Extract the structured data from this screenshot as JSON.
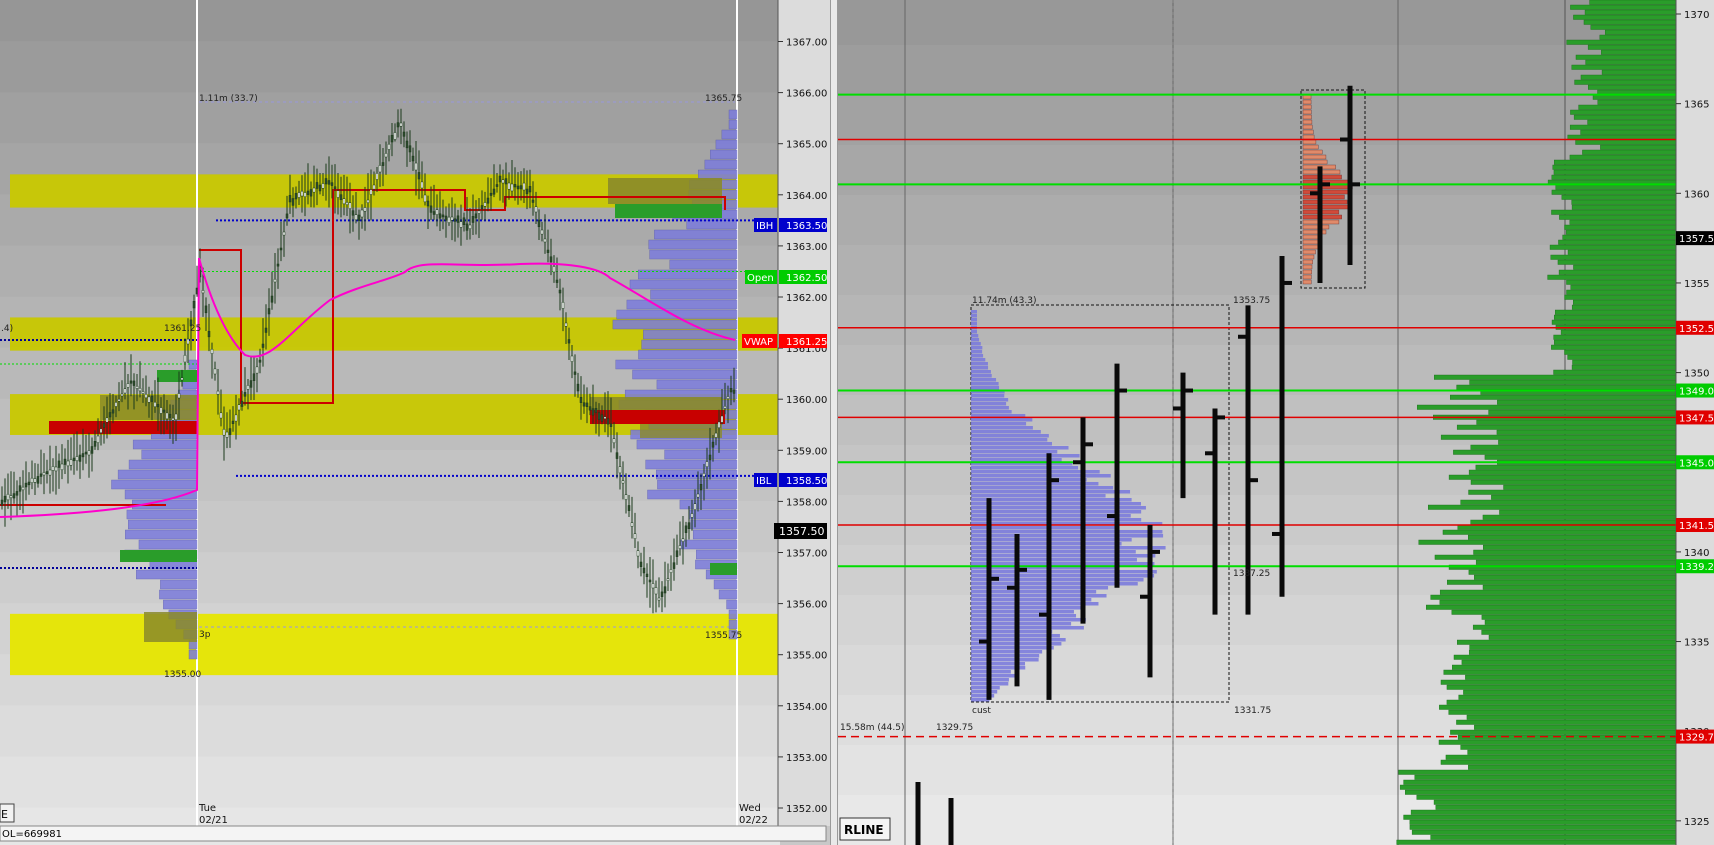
{
  "colors": {
    "yellow_zone": "#c8c800",
    "bright_yellow_zone": "#e6e600",
    "profile_blue": "#7b7bdc",
    "profile_green": "#2a9d2a",
    "profile_olive": "#8a8a2a",
    "profile_red": "#c80000",
    "vwap_magenta": "#ff00cc",
    "ib_blue": "#0000cc",
    "level_green": "#00dd00",
    "level_red": "#e00000",
    "candle": "#1b3a1b",
    "bar_black": "#0a0a0a"
  },
  "left_chart": {
    "price_ticks": [
      "1367.00",
      "1366.00",
      "1365.00",
      "1364.00",
      "1363.00",
      "1362.00",
      "1361.00",
      "1360.00",
      "1359.00",
      "1358.00",
      "1357.00",
      "1356.00",
      "1355.00",
      "1354.00",
      "1353.00",
      "1352.00"
    ],
    "labels": {
      "ibh": {
        "tag": "IBH",
        "value": "1363.50"
      },
      "open": {
        "tag": "Open",
        "value": "1362.50"
      },
      "vwap": {
        "tag": "VWAP",
        "value": "1361.25"
      },
      "ibl": {
        "tag": "IBL",
        "value": "1358.50"
      },
      "last": "1357.50"
    },
    "annotations": {
      "range_top": "1.11m (33.7)",
      "range_high": "1365.75",
      "range_low": "1355.75",
      "prior_level": "1361.25",
      "prior_low": "1355.00",
      "left_stub": ".4)",
      "time_mark": "3p"
    },
    "date_labels": [
      {
        "day": "Tue",
        "date": "02/21"
      },
      {
        "day": "Wed",
        "date": "02/22"
      }
    ],
    "status": {
      "corner_label": "E",
      "volume_text": "OL=669981"
    }
  },
  "right_chart": {
    "price_ticks": [
      "1370",
      "1365",
      "1360",
      "1355",
      "1350",
      "1345",
      "1340",
      "1335",
      "1330",
      "1325"
    ],
    "level_labels": [
      "1357.5",
      "1352.5",
      "1349.0",
      "1347.5",
      "1345.0",
      "1341.5",
      "1339.2",
      "1329.7"
    ],
    "annotations": {
      "profile_stat": "11.74m (43.3)",
      "profile_high": "1353.75",
      "profile_mid": "1337.25",
      "profile_low": "1331.75",
      "profile_name": "cust",
      "composite_stat": "15.58m (44.5)",
      "composite_level": "1329.75"
    },
    "button_label": "RLINE"
  },
  "chart_data": [
    {
      "type": "candlestick",
      "title": "",
      "xlabel": "",
      "ylabel": "",
      "ylim": [
        1351.6,
        1367.6
      ],
      "x_labels": [
        "Tue 02/21",
        "Wed 02/22"
      ],
      "levels": [
        {
          "name": "IBH",
          "value": 1363.5
        },
        {
          "name": "Open",
          "value": 1362.5
        },
        {
          "name": "VWAP",
          "value": 1361.25
        },
        {
          "name": "IBL",
          "value": 1358.5
        },
        {
          "name": "Last",
          "value": 1357.5
        }
      ],
      "session_range": {
        "high": 1365.75,
        "low": 1355.75,
        "volume": "1.11m (33.7)"
      },
      "zones": [
        {
          "from": 1363.75,
          "to": 1364.4,
          "color": "yellow"
        },
        {
          "from": 1360.95,
          "to": 1361.6,
          "color": "yellow"
        },
        {
          "from": 1359.3,
          "to": 1360.1,
          "color": "yellow"
        },
        {
          "from": 1354.6,
          "to": 1355.8,
          "color": "bright-yellow"
        }
      ]
    },
    {
      "type": "bar",
      "title": "",
      "xlabel": "",
      "ylabel": "",
      "ylim": [
        1324,
        1371
      ],
      "levels": [
        {
          "value": 1365.5,
          "color": "green"
        },
        {
          "value": 1363.0,
          "color": "red"
        },
        {
          "value": 1360.5,
          "color": "green"
        },
        {
          "value": 1352.5,
          "color": "red"
        },
        {
          "value": 1349.0,
          "color": "green"
        },
        {
          "value": 1347.5,
          "color": "red"
        },
        {
          "value": 1345.0,
          "color": "green"
        },
        {
          "value": 1341.5,
          "color": "red"
        },
        {
          "value": 1339.2,
          "color": "green"
        },
        {
          "value": 1329.7,
          "color": "red"
        }
      ],
      "ohlc_bars": [
        {
          "high": 1343.0,
          "low": 1331.75,
          "open": 1335.0,
          "close": 1338.5
        },
        {
          "high": 1341.0,
          "low": 1332.5,
          "open": 1338.0,
          "close": 1339.0
        },
        {
          "high": 1345.5,
          "low": 1331.75,
          "open": 1336.5,
          "close": 1344.0
        },
        {
          "high": 1347.5,
          "low": 1336.0,
          "open": 1345.0,
          "close": 1346.0
        },
        {
          "high": 1350.5,
          "low": 1338.0,
          "open": 1342.0,
          "close": 1349.0
        },
        {
          "high": 1341.5,
          "low": 1333.0,
          "open": 1337.5,
          "close": 1340.0
        },
        {
          "high": 1350.0,
          "low": 1343.0,
          "open": 1348.0,
          "close": 1349.0
        },
        {
          "high": 1348.0,
          "low": 1336.5,
          "open": 1345.5,
          "close": 1347.5
        },
        {
          "high": 1353.75,
          "low": 1336.5,
          "open": 1352.0,
          "close": 1344.0
        },
        {
          "high": 1356.5,
          "low": 1337.5,
          "open": 1341.0,
          "close": 1355.0
        },
        {
          "high": 1361.5,
          "low": 1355.0,
          "open": 1360.0,
          "close": 1360.5
        },
        {
          "high": 1366.0,
          "low": 1356.0,
          "open": 1363.0,
          "close": 1360.5
        }
      ],
      "profile_stats": {
        "volume": "11.74m (43.3)",
        "high": 1353.75,
        "low": 1331.75,
        "poc": 1337.25
      },
      "composite": {
        "volume": "15.58m (44.5)",
        "level": 1329.75
      }
    }
  ]
}
